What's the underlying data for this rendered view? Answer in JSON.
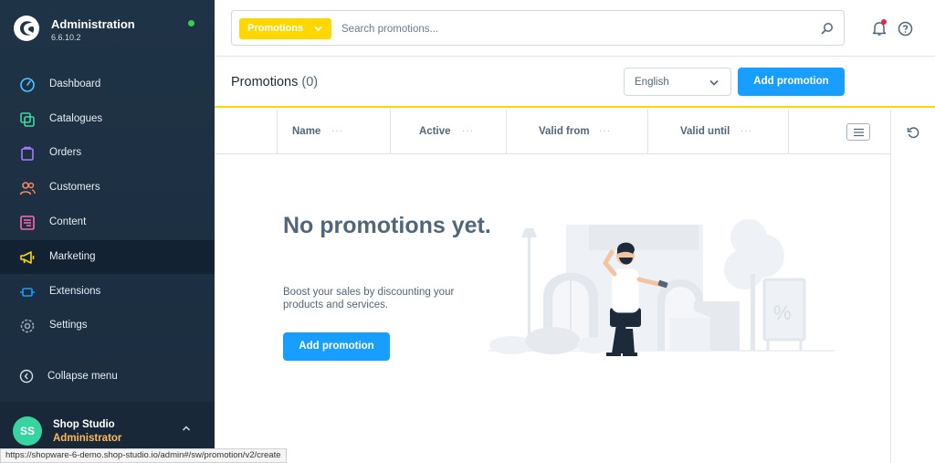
{
  "sidebar": {
    "app_title": "Administration",
    "version": "6.6.10.2",
    "items": [
      {
        "label": "Dashboard",
        "icon": "dashboard-icon"
      },
      {
        "label": "Catalogues",
        "icon": "catalogues-icon"
      },
      {
        "label": "Orders",
        "icon": "orders-icon"
      },
      {
        "label": "Customers",
        "icon": "customers-icon"
      },
      {
        "label": "Content",
        "icon": "content-icon"
      },
      {
        "label": "Marketing",
        "icon": "marketing-icon",
        "active": true
      },
      {
        "label": "Extensions",
        "icon": "extensions-icon"
      },
      {
        "label": "Settings",
        "icon": "settings-icon"
      }
    ],
    "collapse_label": "Collapse menu",
    "user": {
      "initials": "SS",
      "name": "Shop Studio",
      "role": "Administrator"
    }
  },
  "search": {
    "type_label": "Promotions",
    "placeholder": "Search promotions..."
  },
  "header": {
    "title": "Promotions",
    "count": "(0)",
    "language": "English",
    "add_button": "Add promotion"
  },
  "grid": {
    "columns": [
      "Name",
      "Active",
      "Valid from",
      "Valid until"
    ],
    "column_menu": "···"
  },
  "empty_state": {
    "title": "No promotions yet.",
    "text": "Boost your sales by discounting your products and services.",
    "button": "Add promotion"
  },
  "status_url": "https://shopware-6-demo.shop-studio.io/admin#/sw/promotion/v2/create",
  "colors": {
    "sidebar_bg": "#1f3346",
    "accent": "#189eff",
    "highlight": "#ffd700",
    "online": "#37d046",
    "notification": "#de294c"
  }
}
